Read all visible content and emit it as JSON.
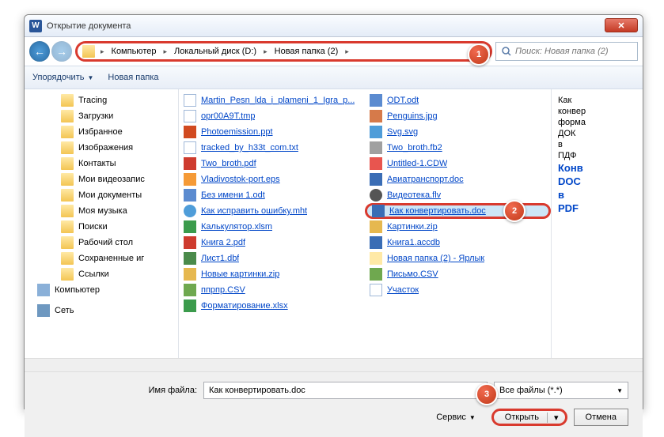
{
  "dialog": {
    "title": "Открытие документа",
    "close": "✕"
  },
  "breadcrumb": {
    "items": [
      "Компьютер",
      "Локальный диск (D:)",
      "Новая папка (2)"
    ]
  },
  "search": {
    "placeholder": "Поиск: Новая папка (2)"
  },
  "toolbar": {
    "organize": "Упорядочить",
    "newfolder": "Новая папка"
  },
  "sidebar": {
    "items": [
      {
        "label": "Tracing",
        "ic": "i-folder"
      },
      {
        "label": "Загрузки",
        "ic": "i-folder"
      },
      {
        "label": "Избранное",
        "ic": "i-folder"
      },
      {
        "label": "Изображения",
        "ic": "i-folder"
      },
      {
        "label": "Контакты",
        "ic": "i-folder"
      },
      {
        "label": "Мои видеозапис",
        "ic": "i-folder"
      },
      {
        "label": "Мои документы",
        "ic": "i-folder"
      },
      {
        "label": "Моя музыка",
        "ic": "i-folder"
      },
      {
        "label": "Поиски",
        "ic": "i-folder"
      },
      {
        "label": "Рабочий стол",
        "ic": "i-folder"
      },
      {
        "label": "Сохраненные иг",
        "ic": "i-folder"
      },
      {
        "label": "Ссылки",
        "ic": "i-folder"
      }
    ],
    "computer": "Компьютер",
    "network": "Сеть"
  },
  "files_col1": [
    {
      "name": "Martin_Pesn_lda_i_plameni_1_Igra_p...",
      "ic": "i-txt"
    },
    {
      "name": "opr00A9T.tmp",
      "ic": "i-txt"
    },
    {
      "name": "Photoemission.ppt",
      "ic": "i-ppt"
    },
    {
      "name": "tracked_by_h33t_com.txt",
      "ic": "i-txt"
    },
    {
      "name": "Two_broth.pdf",
      "ic": "i-pdf"
    },
    {
      "name": "Vladivostok-port.eps",
      "ic": "i-eps"
    },
    {
      "name": "Без имени 1.odt",
      "ic": "i-odt"
    },
    {
      "name": "Как исправить ошибку.mht",
      "ic": "i-mht"
    },
    {
      "name": "Калькулятор.xlsm",
      "ic": "i-xls"
    },
    {
      "name": "Книга 2.pdf",
      "ic": "i-pdf"
    },
    {
      "name": "Лист1.dbf",
      "ic": "i-dbf"
    },
    {
      "name": "Новые картинки.zip",
      "ic": "i-zip"
    },
    {
      "name": "ппрпр.CSV",
      "ic": "i-csv"
    },
    {
      "name": "Форматирование.xlsx",
      "ic": "i-xls"
    }
  ],
  "files_col2": [
    {
      "name": "ODT.odt",
      "ic": "i-odt"
    },
    {
      "name": "Penguins.jpg",
      "ic": "i-jpg"
    },
    {
      "name": "Svg.svg",
      "ic": "i-svg"
    },
    {
      "name": "Two_broth.fb2",
      "ic": "i-fb2"
    },
    {
      "name": "Untitled-1.CDW",
      "ic": "i-cdw"
    },
    {
      "name": "Авиатранспорт.doc",
      "ic": "i-doc"
    },
    {
      "name": "Видеотека.flv",
      "ic": "i-flv"
    },
    {
      "name": "Как конвертировать.doc",
      "ic": "i-doc",
      "selected": true
    },
    {
      "name": "Картинки.zip",
      "ic": "i-zip"
    },
    {
      "name": "Книга1.accdb",
      "ic": "i-doc"
    },
    {
      "name": "Новая папка (2) - Ярлык",
      "ic": "i-lnk"
    },
    {
      "name": "Письмо.CSV",
      "ic": "i-csv"
    },
    {
      "name": "Участок",
      "ic": "i-txt"
    }
  ],
  "preview": {
    "lines": [
      "Как",
      "конвер",
      "форма",
      "ДОК",
      "в",
      "ПДФ",
      "",
      "Конв",
      "DOC",
      "в",
      "PDF"
    ]
  },
  "footer": {
    "fname_label": "Имя файла:",
    "fname_value": "Как конвертировать.doc",
    "filter": "Все файлы (*.*)",
    "service": "Сервис",
    "open": "Открыть",
    "cancel": "Отмена"
  },
  "badges": {
    "b1": "1",
    "b2": "2",
    "b3": "3"
  }
}
